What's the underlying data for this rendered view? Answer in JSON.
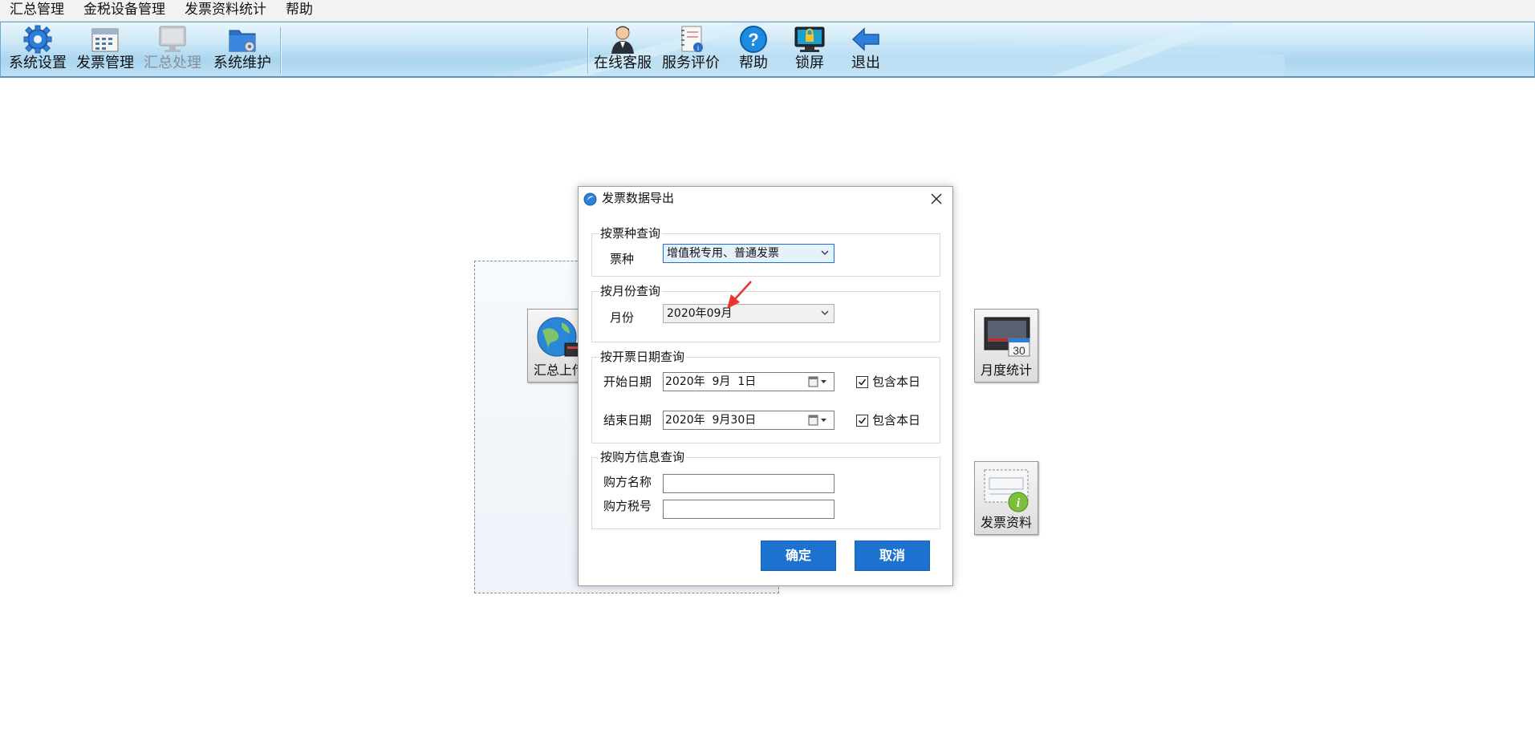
{
  "menu": [
    "汇总管理",
    "金税设备管理",
    "发票资料统计",
    "帮助"
  ],
  "toolbar": {
    "left": [
      {
        "label": "系统设置",
        "icon": "gear-icon"
      },
      {
        "label": "发票管理",
        "icon": "invoice-icon"
      },
      {
        "label": "汇总处理",
        "icon": "monitor-icon",
        "disabled": true
      },
      {
        "label": "系统维护",
        "icon": "maintenance-icon"
      }
    ],
    "right": [
      {
        "label": "在线客服",
        "icon": "person-icon"
      },
      {
        "label": "服务评价",
        "icon": "notebook-icon"
      },
      {
        "label": "帮助",
        "icon": "help-icon"
      },
      {
        "label": "锁屏",
        "icon": "lock-screen-icon"
      },
      {
        "label": "退出",
        "icon": "exit-arrow-icon"
      }
    ]
  },
  "tiles": {
    "upload": "汇总上传",
    "monthly": "月度统计",
    "invoice_data": "发票资料"
  },
  "dialog": {
    "title": "发票数据导出",
    "group_type": {
      "title": "按票种查询",
      "label": "票种",
      "value": "增值税专用、普通发票"
    },
    "group_month": {
      "title": "按月份查询",
      "label": "月份",
      "value": "2020年09月"
    },
    "group_date": {
      "title": "按开票日期查询",
      "start_label": "开始日期",
      "start_value": "2020年  9月  1日",
      "end_label": "结束日期",
      "end_value": "2020年  9月30日",
      "include_label": "包含本日"
    },
    "group_buyer": {
      "title": "按购方信息查询",
      "name_label": "购方名称",
      "tax_label": "购方税号",
      "name_value": "",
      "tax_value": ""
    },
    "ok": "确定",
    "cancel": "取消"
  },
  "colors": {
    "accent": "#1d72d0",
    "toolbar": "#a9d5ef",
    "annotation": "#e8352b"
  }
}
